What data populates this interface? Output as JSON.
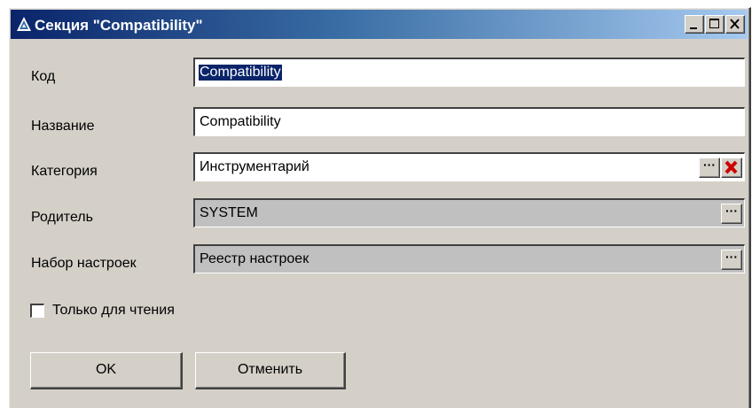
{
  "window": {
    "title": "Секция \"Compatibility\"",
    "controls": {
      "minimize": "_",
      "maximize": "□",
      "close": "×"
    }
  },
  "form": {
    "fields": [
      {
        "label": "Код",
        "value": "Compatibility",
        "selected": true,
        "readonly": false
      },
      {
        "label": "Название",
        "value": "Compatibility",
        "readonly": false
      },
      {
        "label": "Категория",
        "value": "Инструментарий",
        "readonly": false,
        "buttons": [
          "···",
          "clear-icon"
        ]
      },
      {
        "label": "Родитель",
        "value": "SYSTEM",
        "readonly": true,
        "buttons": [
          "···"
        ]
      },
      {
        "label": "Набор настроек",
        "value": "Реестр настроек",
        "readonly": true,
        "buttons": [
          "···"
        ]
      }
    ],
    "readonly_checkbox": {
      "label": "Только для чтения",
      "checked": false
    }
  },
  "buttons": {
    "ok": "OK",
    "cancel": "Отменить"
  },
  "colors": {
    "titlebar_start": "#0a246a",
    "titlebar_end": "#a6caf0",
    "dialog_bg": "#d4d0c8",
    "readonly_bg": "#c0c0c0",
    "clear_icon": "#cc0000"
  }
}
